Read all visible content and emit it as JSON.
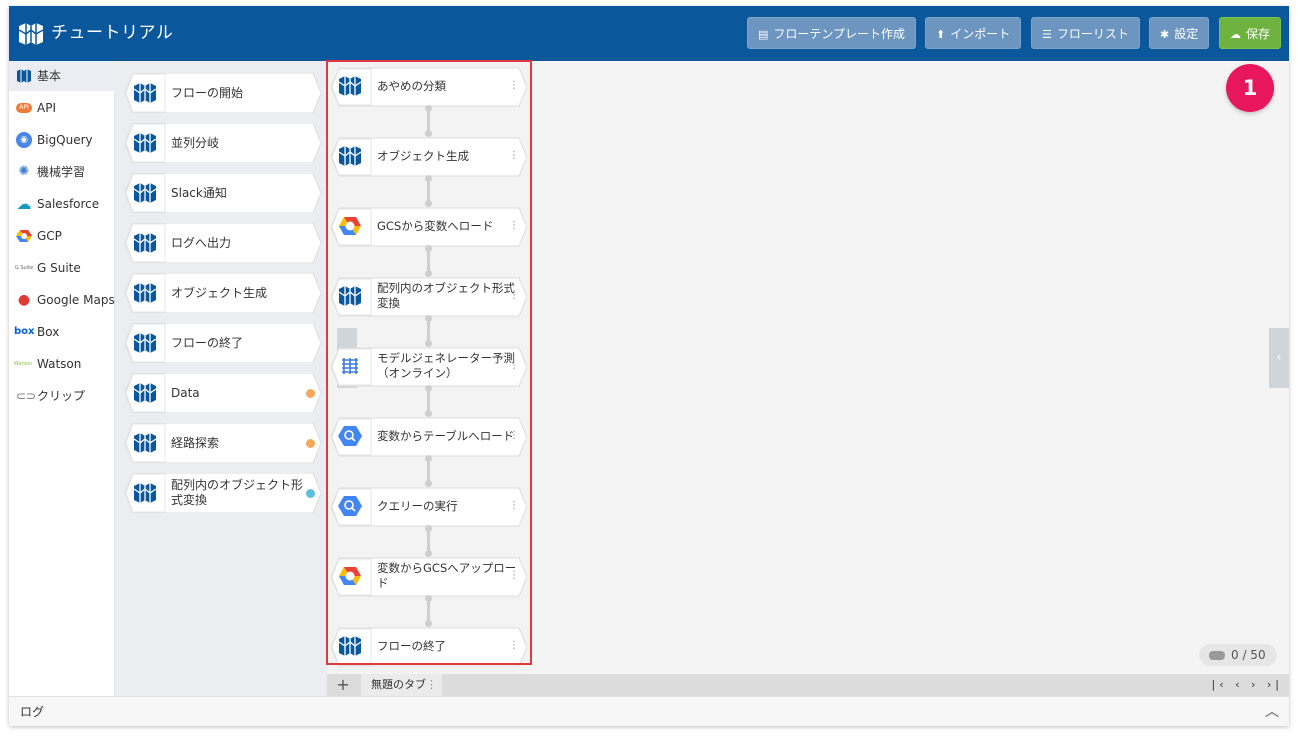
{
  "header": {
    "title": "チュートリアル",
    "buttons": [
      {
        "label": "フローテンプレート作成",
        "icon": "template-icon"
      },
      {
        "label": "インポート",
        "icon": "upload-icon"
      },
      {
        "label": "フローリスト",
        "icon": "list-icon"
      },
      {
        "label": "設定",
        "icon": "gear-icon"
      },
      {
        "label": "保存",
        "icon": "cloud-upload-icon"
      }
    ]
  },
  "callout_badge": "1",
  "sidebar": {
    "items": [
      {
        "label": "基本",
        "icon": "magellan-logo-icon",
        "active": true
      },
      {
        "label": "API",
        "icon": "api-icon"
      },
      {
        "label": "BigQuery",
        "icon": "bigquery-icon"
      },
      {
        "label": "機械学習",
        "icon": "brain-icon"
      },
      {
        "label": "Salesforce",
        "icon": "salesforce-cloud-icon"
      },
      {
        "label": "GCP",
        "icon": "gcp-icon"
      },
      {
        "label": "G Suite",
        "icon": "gsuite-icon",
        "prefix": "G Suite"
      },
      {
        "label": "Google Maps",
        "icon": "map-pin-icon"
      },
      {
        "label": "Box",
        "icon": "box-icon",
        "prefix": "box"
      },
      {
        "label": "Watson",
        "icon": "watson-icon",
        "prefix": "Watson"
      },
      {
        "label": "クリップ",
        "icon": "paperclip-icon"
      }
    ]
  },
  "palette": {
    "items": [
      {
        "label": "フローの開始"
      },
      {
        "label": "並列分岐"
      },
      {
        "label": "Slack通知"
      },
      {
        "label": "ログへ出力"
      },
      {
        "label": "オブジェクト生成"
      },
      {
        "label": "フローの終了"
      },
      {
        "label": "Data",
        "dot": "#f5a75a"
      },
      {
        "label": "経路探索",
        "dot": "#f5a75a"
      },
      {
        "label": "配列内のオブジェクト形式変換",
        "dot": "#5bc0de"
      }
    ]
  },
  "flow": {
    "nodes": [
      {
        "label": "あやめの分類",
        "icon": "magellan-logo-icon"
      },
      {
        "label": "オブジェクト生成",
        "icon": "magellan-logo-icon"
      },
      {
        "label": "GCSから変数へロード",
        "icon": "gcp-icon"
      },
      {
        "label": "配列内のオブジェクト形式変換",
        "icon": "magellan-logo-icon"
      },
      {
        "label": "モデルジェネレーター予測（オンライン）",
        "icon": "brain-icon"
      },
      {
        "label": "変数からテーブルへロード",
        "icon": "bigquery-icon"
      },
      {
        "label": "クエリーの実行",
        "icon": "bigquery-icon"
      },
      {
        "label": "変数からGCSへアップロード",
        "icon": "gcp-icon"
      },
      {
        "label": "フローの終了",
        "icon": "magellan-logo-icon"
      }
    ],
    "kebab": "⋮"
  },
  "canvas": {
    "counter": "0 / 50"
  },
  "tabs": {
    "add": "+",
    "items": [
      {
        "label": "無題のタブ"
      }
    ],
    "pager": "|‹ ‹ › ›|"
  },
  "log": {
    "title": "ログ",
    "caret": "︿"
  },
  "colors": {
    "header": "#0a579b",
    "save": "#6eb33f",
    "badge": "#e8175d",
    "highlight": "#e0393e"
  }
}
